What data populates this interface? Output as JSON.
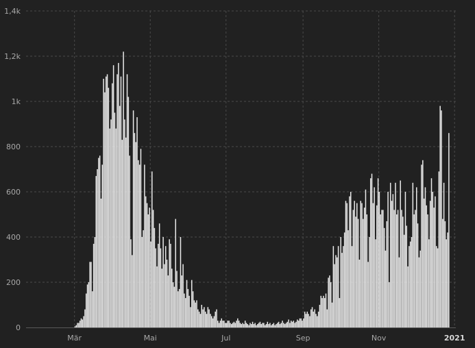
{
  "chart_data": {
    "type": "bar",
    "colors": {
      "background": "#212121",
      "bars": "#ececec",
      "grid": "#4a4a4a",
      "text": "#a8a8a8"
    },
    "grid": true,
    "ylim": [
      0,
      1400
    ],
    "y_ticks": [
      {
        "value": 0,
        "label": "0"
      },
      {
        "value": 200,
        "label": "200"
      },
      {
        "value": 400,
        "label": "400"
      },
      {
        "value": 600,
        "label": "600"
      },
      {
        "value": 800,
        "label": "800"
      },
      {
        "value": 1000,
        "label": "1k"
      },
      {
        "value": 1200,
        "label": "1,2k"
      },
      {
        "value": 1400,
        "label": "1,4k"
      }
    ],
    "x_range": [
      "2020-01-22",
      "2021-01-02"
    ],
    "x_ticks": [
      {
        "date": "2020-03-01",
        "label": "Mär"
      },
      {
        "date": "2020-05-01",
        "label": "Mai"
      },
      {
        "date": "2020-07-01",
        "label": "Jul"
      },
      {
        "date": "2020-09-01",
        "label": "Sep"
      },
      {
        "date": "2020-11-01",
        "label": "Nov"
      },
      {
        "date": "2021-01-01",
        "label": "2021",
        "bold": true
      }
    ],
    "start_date": "2020-02-29",
    "values": [
      0,
      5,
      10,
      20,
      20,
      30,
      40,
      35,
      50,
      80,
      150,
      190,
      200,
      290,
      290,
      160,
      370,
      400,
      670,
      700,
      750,
      760,
      570,
      720,
      1100,
      1040,
      1110,
      1120,
      1060,
      880,
      920,
      1080,
      1160,
      950,
      880,
      1120,
      1170,
      980,
      1110,
      830,
      1220,
      920,
      840,
      1120,
      1020,
      760,
      390,
      320,
      960,
      860,
      820,
      930,
      740,
      720,
      790,
      400,
      430,
      720,
      580,
      550,
      500,
      530,
      380,
      690,
      520,
      440,
      350,
      270,
      370,
      460,
      350,
      260,
      400,
      280,
      360,
      300,
      230,
      390,
      370,
      260,
      200,
      180,
      480,
      250,
      160,
      170,
      400,
      230,
      280,
      150,
      130,
      210,
      170,
      140,
      90,
      210,
      160,
      120,
      110,
      120,
      80,
      70,
      60,
      100,
      80,
      90,
      70,
      60,
      90,
      80,
      60,
      50,
      40,
      50,
      70,
      80,
      30,
      20,
      30,
      40,
      30,
      30,
      20,
      20,
      30,
      30,
      20,
      15,
      20,
      25,
      20,
      30,
      40,
      30,
      20,
      15,
      20,
      15,
      30,
      20,
      15,
      10,
      20,
      15,
      25,
      15,
      20,
      10,
      15,
      20,
      25,
      15,
      20,
      20,
      10,
      15,
      25,
      15,
      20,
      10,
      15,
      20,
      10,
      15,
      20,
      25,
      15,
      20,
      30,
      20,
      15,
      20,
      25,
      35,
      20,
      30,
      25,
      30,
      20,
      25,
      35,
      30,
      40,
      40,
      30,
      40,
      70,
      60,
      70,
      60,
      50,
      80,
      90,
      70,
      80,
      60,
      50,
      70,
      100,
      140,
      130,
      140,
      130,
      150,
      80,
      220,
      230,
      200,
      110,
      360,
      280,
      320,
      310,
      360,
      130,
      400,
      330,
      360,
      420,
      560,
      550,
      430,
      580,
      600,
      360,
      520,
      560,
      490,
      550,
      480,
      300,
      560,
      550,
      480,
      530,
      610,
      500,
      290,
      400,
      660,
      680,
      550,
      620,
      390,
      540,
      660,
      600,
      500,
      520,
      520,
      440,
      340,
      470,
      600,
      200,
      640,
      560,
      590,
      520,
      640,
      500,
      520,
      310,
      650,
      520,
      490,
      410,
      600,
      450,
      270,
      360,
      380,
      400,
      640,
      500,
      520,
      620,
      460,
      310,
      340,
      720,
      740,
      570,
      620,
      540,
      500,
      390,
      560,
      660,
      600,
      530,
      580,
      360,
      350,
      690,
      980,
      960,
      480,
      640,
      470,
      390,
      420,
      860
    ]
  }
}
